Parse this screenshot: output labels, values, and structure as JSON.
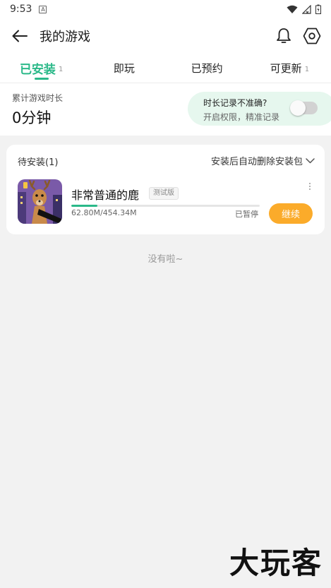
{
  "status_bar": {
    "time": "9:53",
    "notif_icon_text": "A"
  },
  "app_bar": {
    "title": "我的游戏",
    "icons": [
      "back-arrow-icon",
      "bell-icon",
      "settings-hex-icon"
    ]
  },
  "tabs": [
    {
      "label": "已安装",
      "count": "1",
      "active": true
    },
    {
      "label": "即玩",
      "count": "",
      "active": false
    },
    {
      "label": "已预约",
      "count": "",
      "active": false
    },
    {
      "label": "可更新",
      "count": "1",
      "active": false
    }
  ],
  "summary": {
    "label": "累计游戏时长",
    "value": "0分钟",
    "permission_title": "时长记录不准确?",
    "permission_subtitle": "开启权限，精准记录",
    "toggle_on": false
  },
  "pending": {
    "header": "待安装(1)",
    "auto_delete_label": "安装后自动删除安装包",
    "game": {
      "name": "非常普通的鹿",
      "badge": "测试版",
      "size_text": "62.80M/454.34M",
      "progress": 0.138,
      "state": "已暂停",
      "action_label": "继续"
    }
  },
  "empty_text": "没有啦~",
  "watermark": "大玩客",
  "colors": {
    "accent": "#2bb989",
    "action": "#fbab2a",
    "background": "#f2f2f2"
  }
}
